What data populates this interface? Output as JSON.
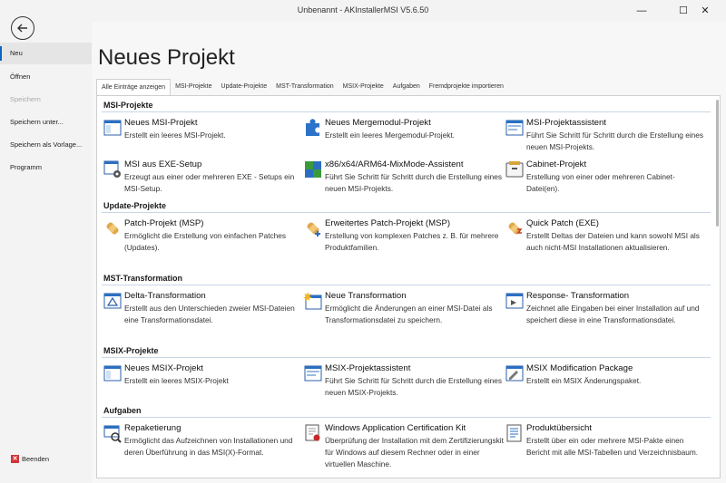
{
  "window": {
    "title": "Unbenannt - AKInstallerMSI V5.6.50",
    "min_glyph": "—",
    "max_glyph": "☐",
    "close_glyph": "✕"
  },
  "sidebar": {
    "items": [
      {
        "label": "Neu",
        "active": true
      },
      {
        "label": "Öffnen"
      },
      {
        "label": "Speichern",
        "disabled": true
      },
      {
        "label": "Speichern unter..."
      },
      {
        "label": "Speichern als Vorlage..."
      },
      {
        "label": "Programm"
      }
    ],
    "exit_label": "Beenden"
  },
  "main": {
    "title": "Neues Projekt",
    "tabs": [
      "Alle Einträge anzeigen",
      "MSI-Projekte",
      "Update-Projekte",
      "MST-Transformation",
      "MSIX-Projekte",
      "Aufgaben",
      "Fremdprojekte importieren"
    ],
    "groups": [
      {
        "header": "MSI-Projekte",
        "items": [
          {
            "name": "Neues MSI-Projekt",
            "desc": "Erstellt ein leeres MSI-Projekt.",
            "icon": "window-icon"
          },
          {
            "name": "Neues Mergemodul-Projekt",
            "desc": "Erstellt ein leeres Mergemodul-Projekt.",
            "icon": "puzzle-icon"
          },
          {
            "name": "MSI-Projektassistent",
            "desc": "Führt Sie Schritt für Schritt durch die Erstellung eines neuen MSI-Projekts.",
            "icon": "wizard-window-icon"
          },
          {
            "name": "MSI aus EXE-Setup",
            "desc": "Erzeugt aus einer oder mehreren EXE - Setups ein MSI-Setup.",
            "icon": "exe-gear-icon"
          },
          {
            "name": "x86/x64/ARM64-MixMode-Assistent",
            "desc": "Führt Sie Schritt für Schritt durch die Erstellung eines neuen MSI-Projekts.",
            "icon": "mixmode-icon"
          },
          {
            "name": "Cabinet-Projekt",
            "desc": "Erstellung von einer oder mehreren Cabinet-Datei(en).",
            "icon": "cabinet-icon"
          }
        ]
      },
      {
        "header": "Update-Projekte",
        "items": [
          {
            "name": "Patch-Projekt (MSP)",
            "desc": "Ermöglicht die Erstellung von einfachen Patches (Updates).",
            "icon": "patch-icon"
          },
          {
            "name": "Erweitertes Patch-Projekt (MSP)",
            "desc": "Erstellung von komplexen Patches z. B. für mehrere Produktfamilien.",
            "icon": "patch-plus-icon"
          },
          {
            "name": "Quick Patch (EXE)",
            "desc": "Erstellt Deltas der Dateien und kann sowohl MSI als auch nicht-MSI Installationen aktualisieren.",
            "icon": "quick-patch-icon"
          }
        ]
      },
      {
        "header": "MST-Transformation",
        "items": [
          {
            "name": "Delta-Transformation",
            "desc": "Erstellt aus den Unterschieden zweier MSI-Dateien eine Transformationsdatei.",
            "icon": "delta-icon"
          },
          {
            "name": "Neue Transformation",
            "desc": "Ermöglicht die Änderungen an einer MSI-Datei als Transformationsdatei zu speichern.",
            "icon": "new-transform-icon"
          },
          {
            "name": "Response- Transformation",
            "desc": "Zeichnet alle Eingaben bei einer Installation auf und speichert diese in eine Transformationsdatei.",
            "icon": "response-icon"
          }
        ]
      },
      {
        "header": "MSIX-Projekte",
        "items": [
          {
            "name": "Neues MSIX-Projekt",
            "desc": "Erstellt ein leeres MSIX-Projekt",
            "icon": "window-icon"
          },
          {
            "name": "MSIX-Projektassistent",
            "desc": "Führt Sie Schritt für Schritt durch die Erstellung eines neuen MSIX-Projekts.",
            "icon": "wizard-window-icon"
          },
          {
            "name": "MSIX Modification Package",
            "desc": "Erstellt ein MSIX Änderungspaket.",
            "icon": "modification-icon"
          }
        ]
      },
      {
        "header": "Aufgaben",
        "items": [
          {
            "name": "Repaketierung",
            "desc": "Ermöglicht das Aufzeichnen von Installationen und deren Überführung in das MSI(X)-Format.",
            "icon": "repackage-icon"
          },
          {
            "name": "Windows Application Certification Kit",
            "desc": "Überprüfung der Installation mit dem Zertifizierungskit für Windows auf diesem Rechner oder in einer virtuellen Maschine.",
            "icon": "certificate-icon"
          },
          {
            "name": "Produktübersicht",
            "desc": "Erstellt über ein oder mehrere MSI-Pakte einen Bericht mit alle MSI-Tabellen und Verzeichnisbaum.",
            "icon": "report-icon"
          }
        ]
      }
    ]
  }
}
